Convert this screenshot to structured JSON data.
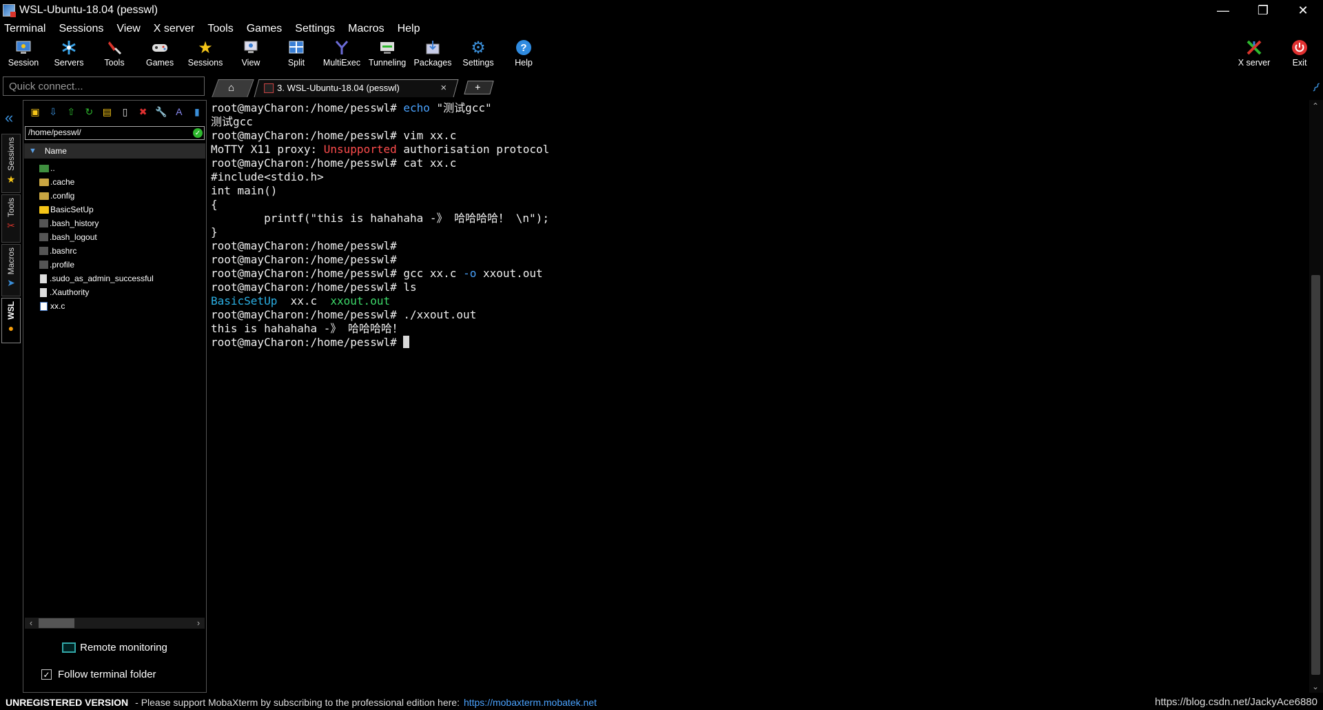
{
  "window": {
    "title": "WSL-Ubuntu-18.04 (pesswl)",
    "controls": {
      "minimize": "—",
      "restore": "❐",
      "close": "✕"
    }
  },
  "menu": [
    "Terminal",
    "Sessions",
    "View",
    "X server",
    "Tools",
    "Games",
    "Settings",
    "Macros",
    "Help"
  ],
  "toolbar": {
    "session": "Session",
    "servers": "Servers",
    "tools": "Tools",
    "games": "Games",
    "sessions": "Sessions",
    "view": "View",
    "split": "Split",
    "multiexec": "MultiExec",
    "tunneling": "Tunneling",
    "packages": "Packages",
    "settings": "Settings",
    "help": "Help",
    "xserver": "X server",
    "exit": "Exit"
  },
  "quick_connect": {
    "placeholder": "Quick connect..."
  },
  "tabs": {
    "home": "⌂",
    "session": "3. WSL-Ubuntu-18.04 (pesswl)",
    "close": "×",
    "new": "+"
  },
  "side_tabs": {
    "sessions": "Sessions",
    "tools": "Tools",
    "macros": "Macros",
    "wsl": "WSL"
  },
  "file_browser": {
    "path": "/home/pesswl/",
    "column": "Name",
    "files": [
      {
        "name": "..",
        "type": "up"
      },
      {
        "name": ".cache",
        "type": "folder"
      },
      {
        "name": ".config",
        "type": "folder"
      },
      {
        "name": "BasicSetUp",
        "type": "folder-yellow"
      },
      {
        "name": ".bash_history",
        "type": "doc"
      },
      {
        "name": ".bash_logout",
        "type": "doc"
      },
      {
        "name": ".bashrc",
        "type": "doc"
      },
      {
        "name": ".profile",
        "type": "doc"
      },
      {
        "name": ".sudo_as_admin_successful",
        "type": "doc-white"
      },
      {
        "name": ".Xauthority",
        "type": "doc-white"
      },
      {
        "name": "xx.c",
        "type": "c-file"
      }
    ],
    "remote_monitoring": "Remote monitoring",
    "follow_folder": "Follow terminal folder",
    "follow_checked": true
  },
  "terminal": {
    "prompt": "root@mayCharon:/home/pesswl#",
    "lines": [
      {
        "p": "root@mayCharon:/home/pesswl# ",
        "cmd": "echo",
        "rest": " \"测试gcc\""
      },
      {
        "text": "测试gcc"
      },
      {
        "p": "root@mayCharon:/home/pesswl# ",
        "rest": "vim xx.c"
      },
      {
        "text": "MoTTY X11 proxy: ",
        "red": "Unsupported",
        "after": " authorisation protocol"
      },
      {
        "p": "root@mayCharon:/home/pesswl# ",
        "rest": "cat xx.c"
      },
      {
        "text": "#include<stdio.h>"
      },
      {
        "text": "int main()"
      },
      {
        "text": "{"
      },
      {
        "text": "        printf(\"this is hahahaha -》 哈哈哈哈！ \\n\");"
      },
      {
        "text": "}"
      },
      {
        "p": "root@mayCharon:/home/pesswl# ",
        "rest": ""
      },
      {
        "p": "root@mayCharon:/home/pesswl# ",
        "rest": ""
      },
      {
        "p": "root@mayCharon:/home/pesswl# ",
        "rest": "gcc xx.c ",
        "opt": "-o",
        "after": " xxout.out"
      },
      {
        "p": "root@mayCharon:/home/pesswl# ",
        "rest": "ls"
      },
      {
        "ls": [
          "BasicSetUp",
          "xx.c",
          "xxout.out"
        ]
      },
      {
        "p": "root@mayCharon:/home/pesswl# ",
        "rest": "./xxout.out"
      },
      {
        "text": "this is hahahaha -》 哈哈哈哈！"
      },
      {
        "p": "root@mayCharon:/home/pesswl# ",
        "rest": "",
        "cursor": true
      }
    ]
  },
  "status": {
    "unregistered": "UNREGISTERED VERSION",
    "message": "-  Please support MobaXterm by subscribing to the professional edition here:",
    "link": "https://mobaxterm.mobatek.net",
    "watermark": "https://blog.csdn.net/JackyAce6880"
  },
  "colors": {
    "background": "#000000",
    "accent_blue": "#4aa3ff",
    "error_red": "#ff4d4d",
    "exec_green": "#3dd96a",
    "dir_cyan": "#2bb1e6"
  }
}
